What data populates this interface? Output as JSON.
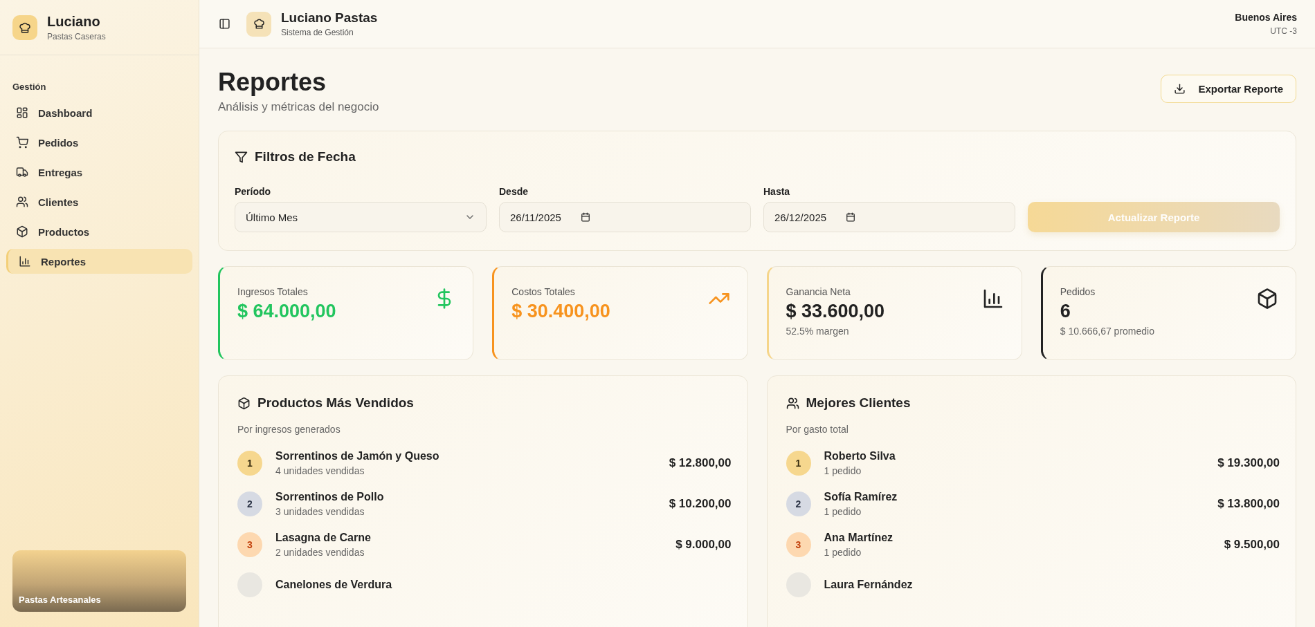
{
  "sidebar": {
    "brand": {
      "title": "Luciano",
      "subtitle": "Pastas Caseras"
    },
    "section_label": "Gestión",
    "items": [
      {
        "label": "Dashboard",
        "selected": false
      },
      {
        "label": "Pedidos",
        "selected": false
      },
      {
        "label": "Entregas",
        "selected": false
      },
      {
        "label": "Clientes",
        "selected": false
      },
      {
        "label": "Productos",
        "selected": false
      },
      {
        "label": "Reportes",
        "selected": true
      }
    ],
    "banner": {
      "caption": "Pastas Artesanales"
    }
  },
  "header": {
    "title": "Luciano Pastas",
    "subtitle": "Sistema de Gestión",
    "location": "Buenos Aires",
    "timezone": "UTC -3"
  },
  "page": {
    "title": "Reportes",
    "subtitle": "Análisis y métricas del negocio",
    "export_button": "Exportar Reporte"
  },
  "filters": {
    "title": "Filtros de Fecha",
    "period": {
      "label": "Período",
      "value": "Último Mes"
    },
    "from": {
      "label": "Desde",
      "value": "26/11/2025"
    },
    "to": {
      "label": "Hasta",
      "value": "26/12/2025"
    },
    "update_button": {
      "label": "Actualizar Reporte",
      "disabled": true
    }
  },
  "stats": [
    {
      "kind": "income",
      "label": "Ingresos Totales",
      "value": "$ 64.000,00"
    },
    {
      "kind": "cost",
      "label": "Costos Totales",
      "value": "$ 30.400,00"
    },
    {
      "kind": "profit",
      "label": "Ganancia Neta",
      "value": "$ 33.600,00",
      "note": "52.5% margen"
    },
    {
      "kind": "orders",
      "label": "Pedidos",
      "value": "6",
      "note": "$ 10.666,67 promedio"
    }
  ],
  "top_products": {
    "title": "Productos Más Vendidos",
    "subtitle": "Por ingresos generados",
    "rows": [
      {
        "rank": "1",
        "color": "#f6d78e",
        "name": "Sorrentinos de Jamón y Queso",
        "detail": "4 unidades vendidas",
        "amount": "$ 12.800,00"
      },
      {
        "rank": "2",
        "color": "#d6dae3",
        "name": "Sorrentinos de Pollo",
        "detail": "3 unidades vendidas",
        "amount": "$ 10.200,00"
      },
      {
        "rank": "3",
        "color": "#fdd8b0",
        "name": "Lasagna de Carne",
        "detail": "2 unidades vendidas",
        "amount": "$ 9.000,00"
      },
      {
        "color": "#e9e7e1",
        "name": "Canelones de Verdura"
      }
    ]
  },
  "top_clients": {
    "title": "Mejores Clientes",
    "subtitle": "Por gasto total",
    "rows": [
      {
        "rank": "1",
        "color": "#f6d78e",
        "name": "Roberto Silva",
        "detail": "1 pedido",
        "amount": "$ 19.300,00"
      },
      {
        "rank": "2",
        "color": "#d6dae3",
        "name": "Sofía Ramírez",
        "detail": "1 pedido",
        "amount": "$ 13.800,00"
      },
      {
        "rank": "3",
        "color": "#fdd8b0",
        "name": "Ana Martínez",
        "detail": "1 pedido",
        "amount": "$ 9.500,00"
      },
      {
        "color": "#e9e7e1",
        "name": "Laura Fernández"
      }
    ]
  }
}
